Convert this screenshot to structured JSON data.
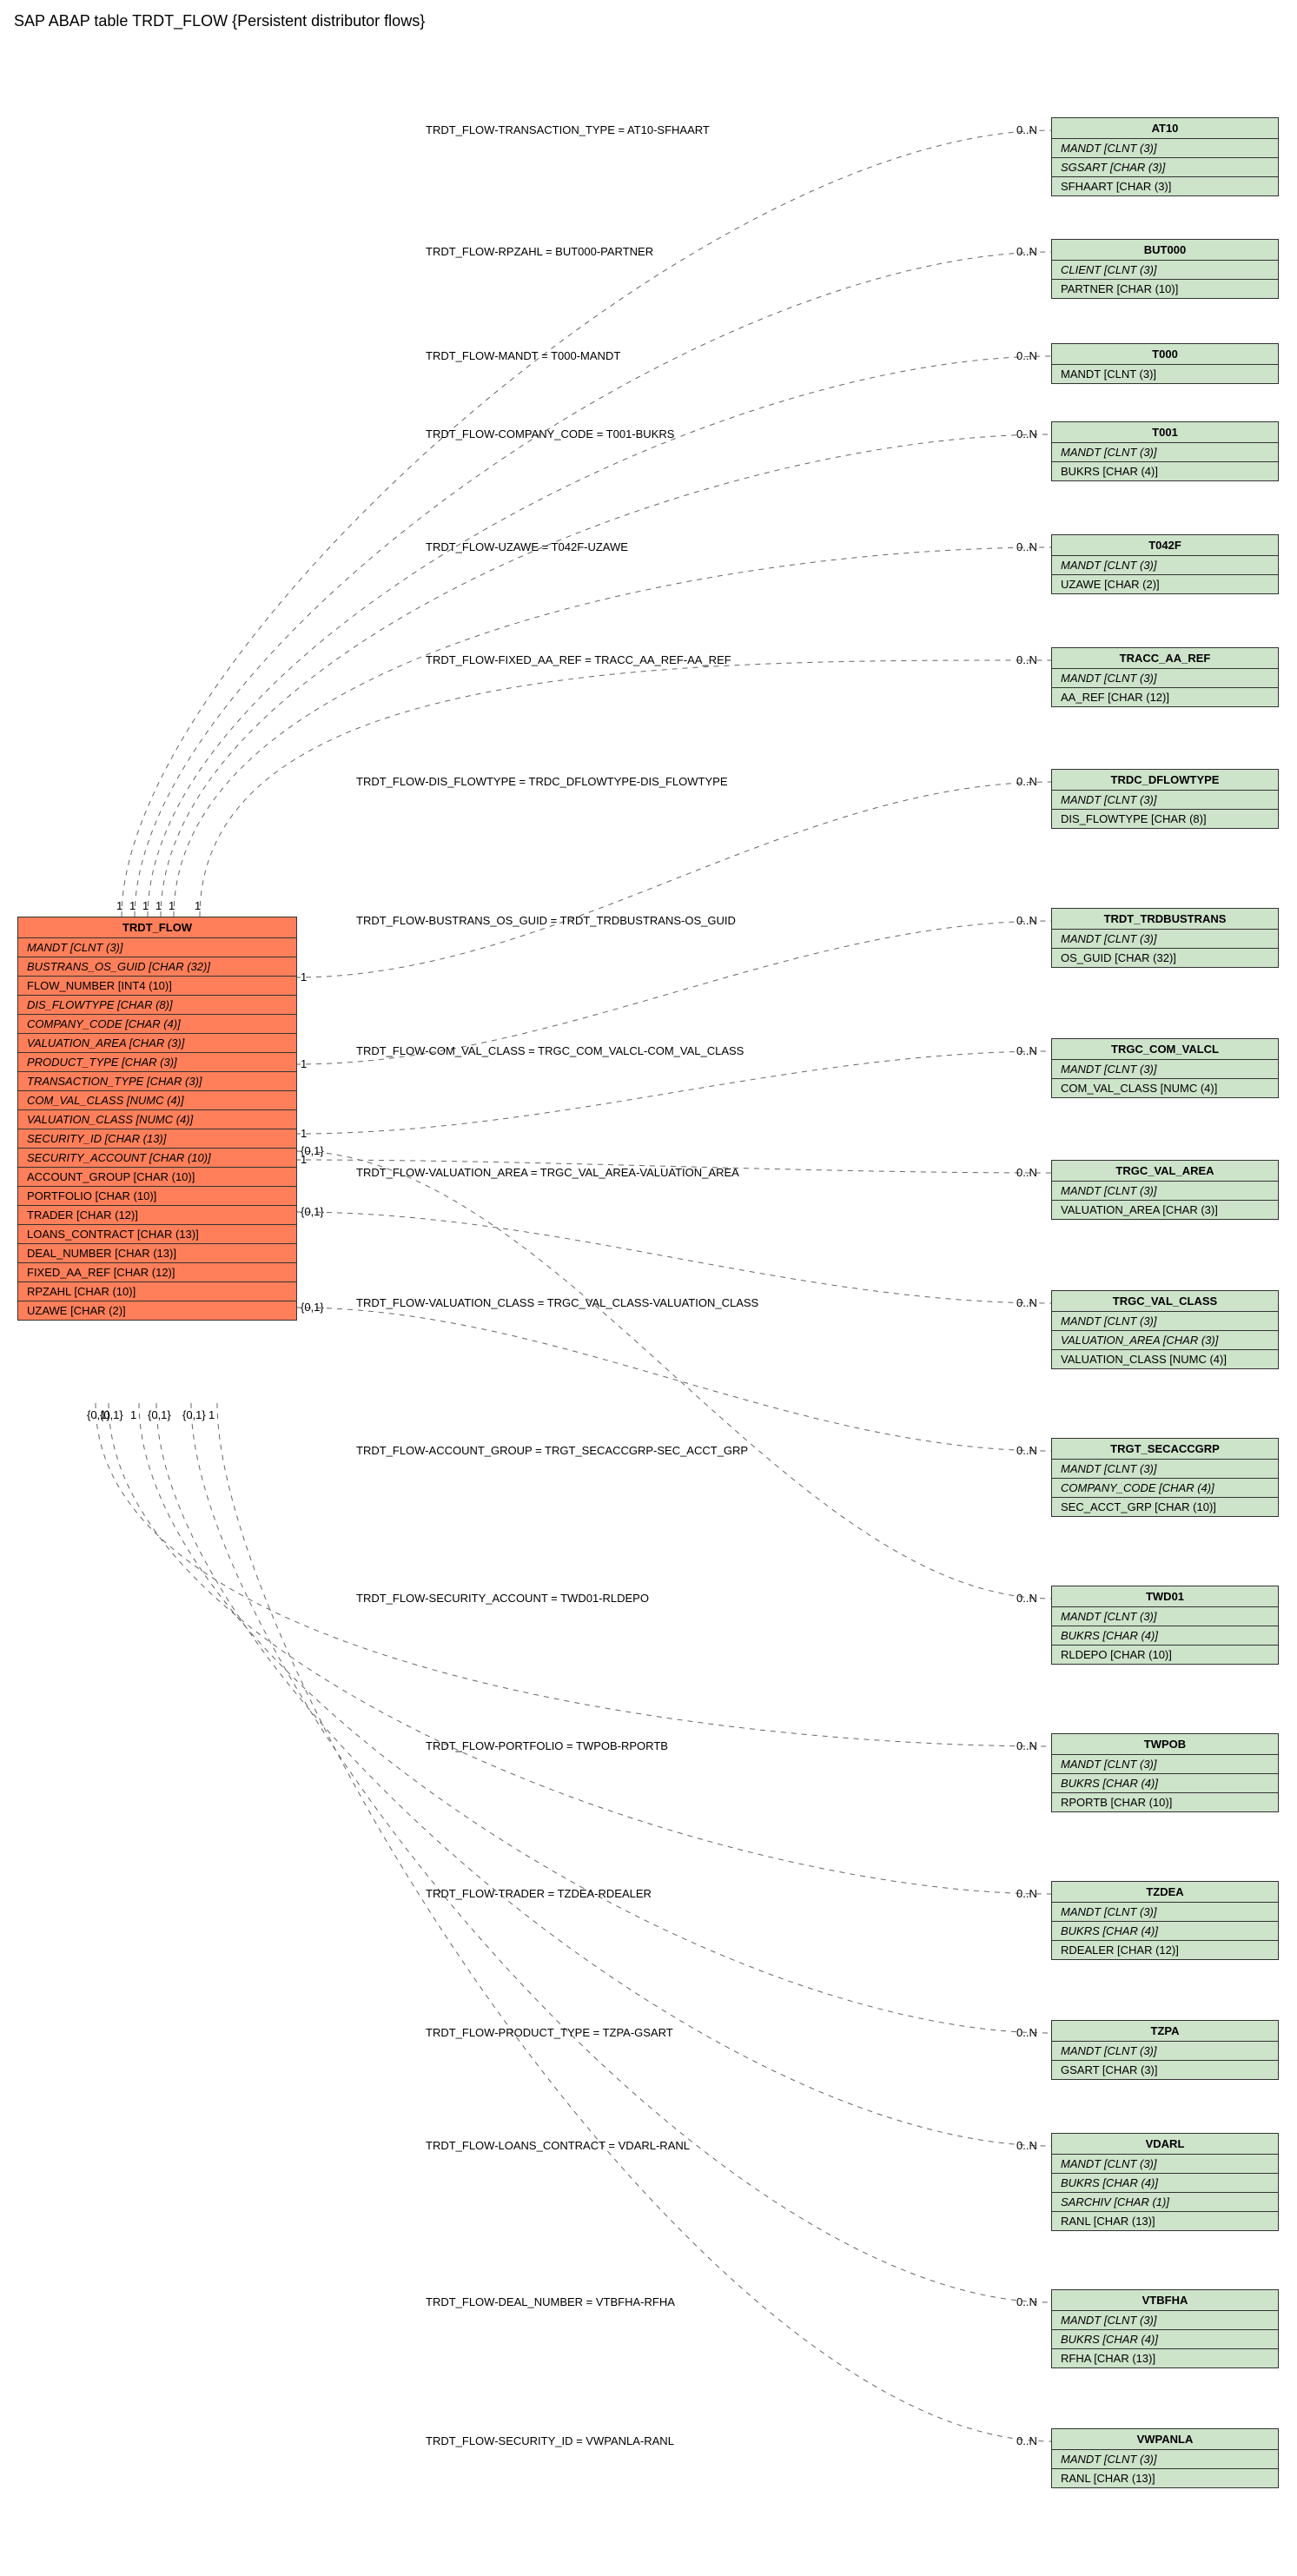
{
  "title": "SAP ABAP table TRDT_FLOW {Persistent distributor flows}",
  "main_entity": {
    "name": "TRDT_FLOW",
    "fields": [
      {
        "name": "MANDT",
        "type": "CLNT (3)",
        "key": true
      },
      {
        "name": "BUSTRANS_OS_GUID",
        "type": "CHAR (32)",
        "key": true
      },
      {
        "name": "FLOW_NUMBER",
        "type": "INT4 (10)",
        "key": false
      },
      {
        "name": "DIS_FLOWTYPE",
        "type": "CHAR (8)",
        "key": true
      },
      {
        "name": "COMPANY_CODE",
        "type": "CHAR (4)",
        "key": true
      },
      {
        "name": "VALUATION_AREA",
        "type": "CHAR (3)",
        "key": true
      },
      {
        "name": "PRODUCT_TYPE",
        "type": "CHAR (3)",
        "key": true
      },
      {
        "name": "TRANSACTION_TYPE",
        "type": "CHAR (3)",
        "key": true
      },
      {
        "name": "COM_VAL_CLASS",
        "type": "NUMC (4)",
        "key": true
      },
      {
        "name": "VALUATION_CLASS",
        "type": "NUMC (4)",
        "key": true
      },
      {
        "name": "SECURITY_ID",
        "type": "CHAR (13)",
        "key": true
      },
      {
        "name": "SECURITY_ACCOUNT",
        "type": "CHAR (10)",
        "key": true
      },
      {
        "name": "ACCOUNT_GROUP",
        "type": "CHAR (10)",
        "key": false
      },
      {
        "name": "PORTFOLIO",
        "type": "CHAR (10)",
        "key": false
      },
      {
        "name": "TRADER",
        "type": "CHAR (12)",
        "key": false
      },
      {
        "name": "LOANS_CONTRACT",
        "type": "CHAR (13)",
        "key": false
      },
      {
        "name": "DEAL_NUMBER",
        "type": "CHAR (13)",
        "key": false
      },
      {
        "name": "FIXED_AA_REF",
        "type": "CHAR (12)",
        "key": false
      },
      {
        "name": "RPZAHL",
        "type": "CHAR (10)",
        "key": false
      },
      {
        "name": "UZAWE",
        "type": "CHAR (2)",
        "key": false
      }
    ]
  },
  "ref_entities": [
    {
      "id": "AT10",
      "name": "AT10",
      "fields": [
        {
          "name": "MANDT",
          "type": "CLNT (3)",
          "key": true
        },
        {
          "name": "SGSART",
          "type": "CHAR (3)",
          "key": true
        },
        {
          "name": "SFHAART",
          "type": "CHAR (3)",
          "key": false
        }
      ]
    },
    {
      "id": "BUT000",
      "name": "BUT000",
      "fields": [
        {
          "name": "CLIENT",
          "type": "CLNT (3)",
          "key": true
        },
        {
          "name": "PARTNER",
          "type": "CHAR (10)",
          "key": false
        }
      ]
    },
    {
      "id": "T000",
      "name": "T000",
      "fields": [
        {
          "name": "MANDT",
          "type": "CLNT (3)",
          "key": false
        }
      ]
    },
    {
      "id": "T001",
      "name": "T001",
      "fields": [
        {
          "name": "MANDT",
          "type": "CLNT (3)",
          "key": true
        },
        {
          "name": "BUKRS",
          "type": "CHAR (4)",
          "key": false
        }
      ]
    },
    {
      "id": "T042F",
      "name": "T042F",
      "fields": [
        {
          "name": "MANDT",
          "type": "CLNT (3)",
          "key": true
        },
        {
          "name": "UZAWE",
          "type": "CHAR (2)",
          "key": false
        }
      ]
    },
    {
      "id": "TRACC_AA_REF",
      "name": "TRACC_AA_REF",
      "fields": [
        {
          "name": "MANDT",
          "type": "CLNT (3)",
          "key": true
        },
        {
          "name": "AA_REF",
          "type": "CHAR (12)",
          "key": false
        }
      ]
    },
    {
      "id": "TRDC_DFLOWTYPE",
      "name": "TRDC_DFLOWTYPE",
      "fields": [
        {
          "name": "MANDT",
          "type": "CLNT (3)",
          "key": true
        },
        {
          "name": "DIS_FLOWTYPE",
          "type": "CHAR (8)",
          "key": false
        }
      ]
    },
    {
      "id": "TRDT_TRDBUSTRANS",
      "name": "TRDT_TRDBUSTRANS",
      "fields": [
        {
          "name": "MANDT",
          "type": "CLNT (3)",
          "key": true
        },
        {
          "name": "OS_GUID",
          "type": "CHAR (32)",
          "key": false
        }
      ]
    },
    {
      "id": "TRGC_COM_VALCL",
      "name": "TRGC_COM_VALCL",
      "fields": [
        {
          "name": "MANDT",
          "type": "CLNT (3)",
          "key": true
        },
        {
          "name": "COM_VAL_CLASS",
          "type": "NUMC (4)",
          "key": false
        }
      ]
    },
    {
      "id": "TRGC_VAL_AREA",
      "name": "TRGC_VAL_AREA",
      "fields": [
        {
          "name": "MANDT",
          "type": "CLNT (3)",
          "key": true
        },
        {
          "name": "VALUATION_AREA",
          "type": "CHAR (3)",
          "key": false
        }
      ]
    },
    {
      "id": "TRGC_VAL_CLASS",
      "name": "TRGC_VAL_CLASS",
      "fields": [
        {
          "name": "MANDT",
          "type": "CLNT (3)",
          "key": true
        },
        {
          "name": "VALUATION_AREA",
          "type": "CHAR (3)",
          "key": true
        },
        {
          "name": "VALUATION_CLASS",
          "type": "NUMC (4)",
          "key": false
        }
      ]
    },
    {
      "id": "TRGT_SECACCGRP",
      "name": "TRGT_SECACCGRP",
      "fields": [
        {
          "name": "MANDT",
          "type": "CLNT (3)",
          "key": true
        },
        {
          "name": "COMPANY_CODE",
          "type": "CHAR (4)",
          "key": true
        },
        {
          "name": "SEC_ACCT_GRP",
          "type": "CHAR (10)",
          "key": false
        }
      ]
    },
    {
      "id": "TWD01",
      "name": "TWD01",
      "fields": [
        {
          "name": "MANDT",
          "type": "CLNT (3)",
          "key": true
        },
        {
          "name": "BUKRS",
          "type": "CHAR (4)",
          "key": true
        },
        {
          "name": "RLDEPO",
          "type": "CHAR (10)",
          "key": false
        }
      ]
    },
    {
      "id": "TWPOB",
      "name": "TWPOB",
      "fields": [
        {
          "name": "MANDT",
          "type": "CLNT (3)",
          "key": true
        },
        {
          "name": "BUKRS",
          "type": "CHAR (4)",
          "key": true
        },
        {
          "name": "RPORTB",
          "type": "CHAR (10)",
          "key": false
        }
      ]
    },
    {
      "id": "TZDEA",
      "name": "TZDEA",
      "fields": [
        {
          "name": "MANDT",
          "type": "CLNT (3)",
          "key": true
        },
        {
          "name": "BUKRS",
          "type": "CHAR (4)",
          "key": true
        },
        {
          "name": "RDEALER",
          "type": "CHAR (12)",
          "key": false
        }
      ]
    },
    {
      "id": "TZPA",
      "name": "TZPA",
      "fields": [
        {
          "name": "MANDT",
          "type": "CLNT (3)",
          "key": true
        },
        {
          "name": "GSART",
          "type": "CHAR (3)",
          "key": false
        }
      ]
    },
    {
      "id": "VDARL",
      "name": "VDARL",
      "fields": [
        {
          "name": "MANDT",
          "type": "CLNT (3)",
          "key": true
        },
        {
          "name": "BUKRS",
          "type": "CHAR (4)",
          "key": true
        },
        {
          "name": "SARCHIV",
          "type": "CHAR (1)",
          "key": true
        },
        {
          "name": "RANL",
          "type": "CHAR (13)",
          "key": false
        }
      ]
    },
    {
      "id": "VTBFHA",
      "name": "VTBFHA",
      "fields": [
        {
          "name": "MANDT",
          "type": "CLNT (3)",
          "key": true
        },
        {
          "name": "BUKRS",
          "type": "CHAR (4)",
          "key": true
        },
        {
          "name": "RFHA",
          "type": "CHAR (13)",
          "key": false
        }
      ]
    },
    {
      "id": "VWPANLA",
      "name": "VWPANLA",
      "fields": [
        {
          "name": "MANDT",
          "type": "CLNT (3)",
          "key": true
        },
        {
          "name": "RANL",
          "type": "CHAR (13)",
          "key": false
        }
      ]
    }
  ],
  "relationships": [
    {
      "label": "TRDT_FLOW-TRANSACTION_TYPE = AT10-SFHAART",
      "target": "AT10",
      "card_left": "1",
      "card_right": "0..N"
    },
    {
      "label": "TRDT_FLOW-RPZAHL = BUT000-PARTNER",
      "target": "BUT000",
      "card_left": "1",
      "card_right": "0..N"
    },
    {
      "label": "TRDT_FLOW-MANDT = T000-MANDT",
      "target": "T000",
      "card_left": "1",
      "card_right": "0..N"
    },
    {
      "label": "TRDT_FLOW-COMPANY_CODE = T001-BUKRS",
      "target": "T001",
      "card_left": "1",
      "card_right": "0..N"
    },
    {
      "label": "TRDT_FLOW-UZAWE = T042F-UZAWE",
      "target": "T042F",
      "card_left": "1",
      "card_right": "0..N"
    },
    {
      "label": "TRDT_FLOW-FIXED_AA_REF = TRACC_AA_REF-AA_REF",
      "target": "TRACC_AA_REF",
      "card_left": "1",
      "card_right": "0..N"
    },
    {
      "label": "TRDT_FLOW-DIS_FLOWTYPE = TRDC_DFLOWTYPE-DIS_FLOWTYPE",
      "target": "TRDC_DFLOWTYPE",
      "card_left": "1",
      "card_right": "0..N"
    },
    {
      "label": "TRDT_FLOW-BUSTRANS_OS_GUID = TRDT_TRDBUSTRANS-OS_GUID",
      "target": "TRDT_TRDBUSTRANS",
      "card_left": "1",
      "card_right": "0..N"
    },
    {
      "label": "TRDT_FLOW-COM_VAL_CLASS = TRGC_COM_VALCL-COM_VAL_CLASS",
      "target": "TRGC_COM_VALCL",
      "card_left": "1",
      "card_right": "0..N"
    },
    {
      "label": "TRDT_FLOW-VALUATION_AREA = TRGC_VAL_AREA-VALUATION_AREA",
      "target": "TRGC_VAL_AREA",
      "card_left": "1",
      "card_right": "0..N"
    },
    {
      "label": "TRDT_FLOW-VALUATION_CLASS = TRGC_VAL_CLASS-VALUATION_CLASS",
      "target": "TRGC_VAL_CLASS",
      "card_left": "{0,1}",
      "card_right": "0..N"
    },
    {
      "label": "TRDT_FLOW-ACCOUNT_GROUP = TRGT_SECACCGRP-SEC_ACCT_GRP",
      "target": "TRGT_SECACCGRP",
      "card_left": "{0,1}",
      "card_right": "0..N"
    },
    {
      "label": "TRDT_FLOW-SECURITY_ACCOUNT = TWD01-RLDEPO",
      "target": "TWD01",
      "card_left": "{0,1}",
      "card_right": "0..N"
    },
    {
      "label": "TRDT_FLOW-PORTFOLIO = TWPOB-RPORTB",
      "target": "TWPOB",
      "card_left": "{0,1}",
      "card_right": "0..N"
    },
    {
      "label": "TRDT_FLOW-TRADER = TZDEA-RDEALER",
      "target": "TZDEA",
      "card_left": "{0,1}",
      "card_right": "0..N"
    },
    {
      "label": "TRDT_FLOW-PRODUCT_TYPE = TZPA-GSART",
      "target": "TZPA",
      "card_left": "1",
      "card_right": "0..N"
    },
    {
      "label": "TRDT_FLOW-LOANS_CONTRACT = VDARL-RANL",
      "target": "VDARL",
      "card_left": "{0,1}",
      "card_right": "0..N"
    },
    {
      "label": "TRDT_FLOW-DEAL_NUMBER = VTBFHA-RFHA",
      "target": "VTBFHA",
      "card_left": "{0,1}",
      "card_right": "0..N"
    },
    {
      "label": "TRDT_FLOW-SECURITY_ID = VWPANLA-RANL",
      "target": "VWPANLA",
      "card_left": "1",
      "card_right": "0..N"
    }
  ],
  "bottom_cards": [
    "{0,1}",
    "{0,1}",
    "1",
    "1",
    "{0,1}",
    "1",
    "{0,1}"
  ],
  "top_cards": [
    "1",
    "1",
    "1",
    "1",
    "1",
    "1"
  ]
}
